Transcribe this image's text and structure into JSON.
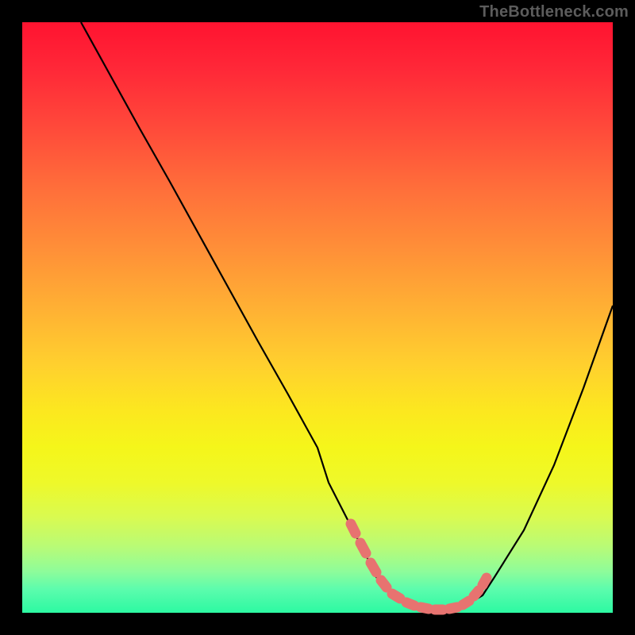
{
  "watermark": {
    "text": "TheBottleneck.com"
  },
  "colors": {
    "curve": "#000000",
    "highlight": "#e77370",
    "gradient_top": "#ff1330",
    "gradient_bottom": "#2cf9a2"
  },
  "chart_data": {
    "type": "line",
    "title": "",
    "xlabel": "",
    "ylabel": "",
    "xlim": [
      0,
      100
    ],
    "ylim": [
      0,
      100
    ],
    "grid": false,
    "legend": false,
    "series": [
      {
        "name": "bottleneck-curve",
        "x": [
          10,
          15,
          20,
          25,
          30,
          35,
          40,
          45,
          50,
          52,
          55,
          58,
          60,
          63,
          65,
          68,
          70,
          73,
          75,
          78,
          80,
          85,
          90,
          95,
          100
        ],
        "y": [
          100,
          91,
          82,
          73,
          64,
          55,
          46,
          37,
          28,
          22,
          16,
          10,
          6,
          3,
          1.5,
          0.8,
          0.5,
          0.6,
          1.2,
          3,
          6,
          14,
          25,
          38,
          52
        ]
      }
    ],
    "highlight_segment": {
      "x_start": 55,
      "x_end": 77,
      "note": "thick salmon dots marking the valley/optimum region"
    }
  }
}
